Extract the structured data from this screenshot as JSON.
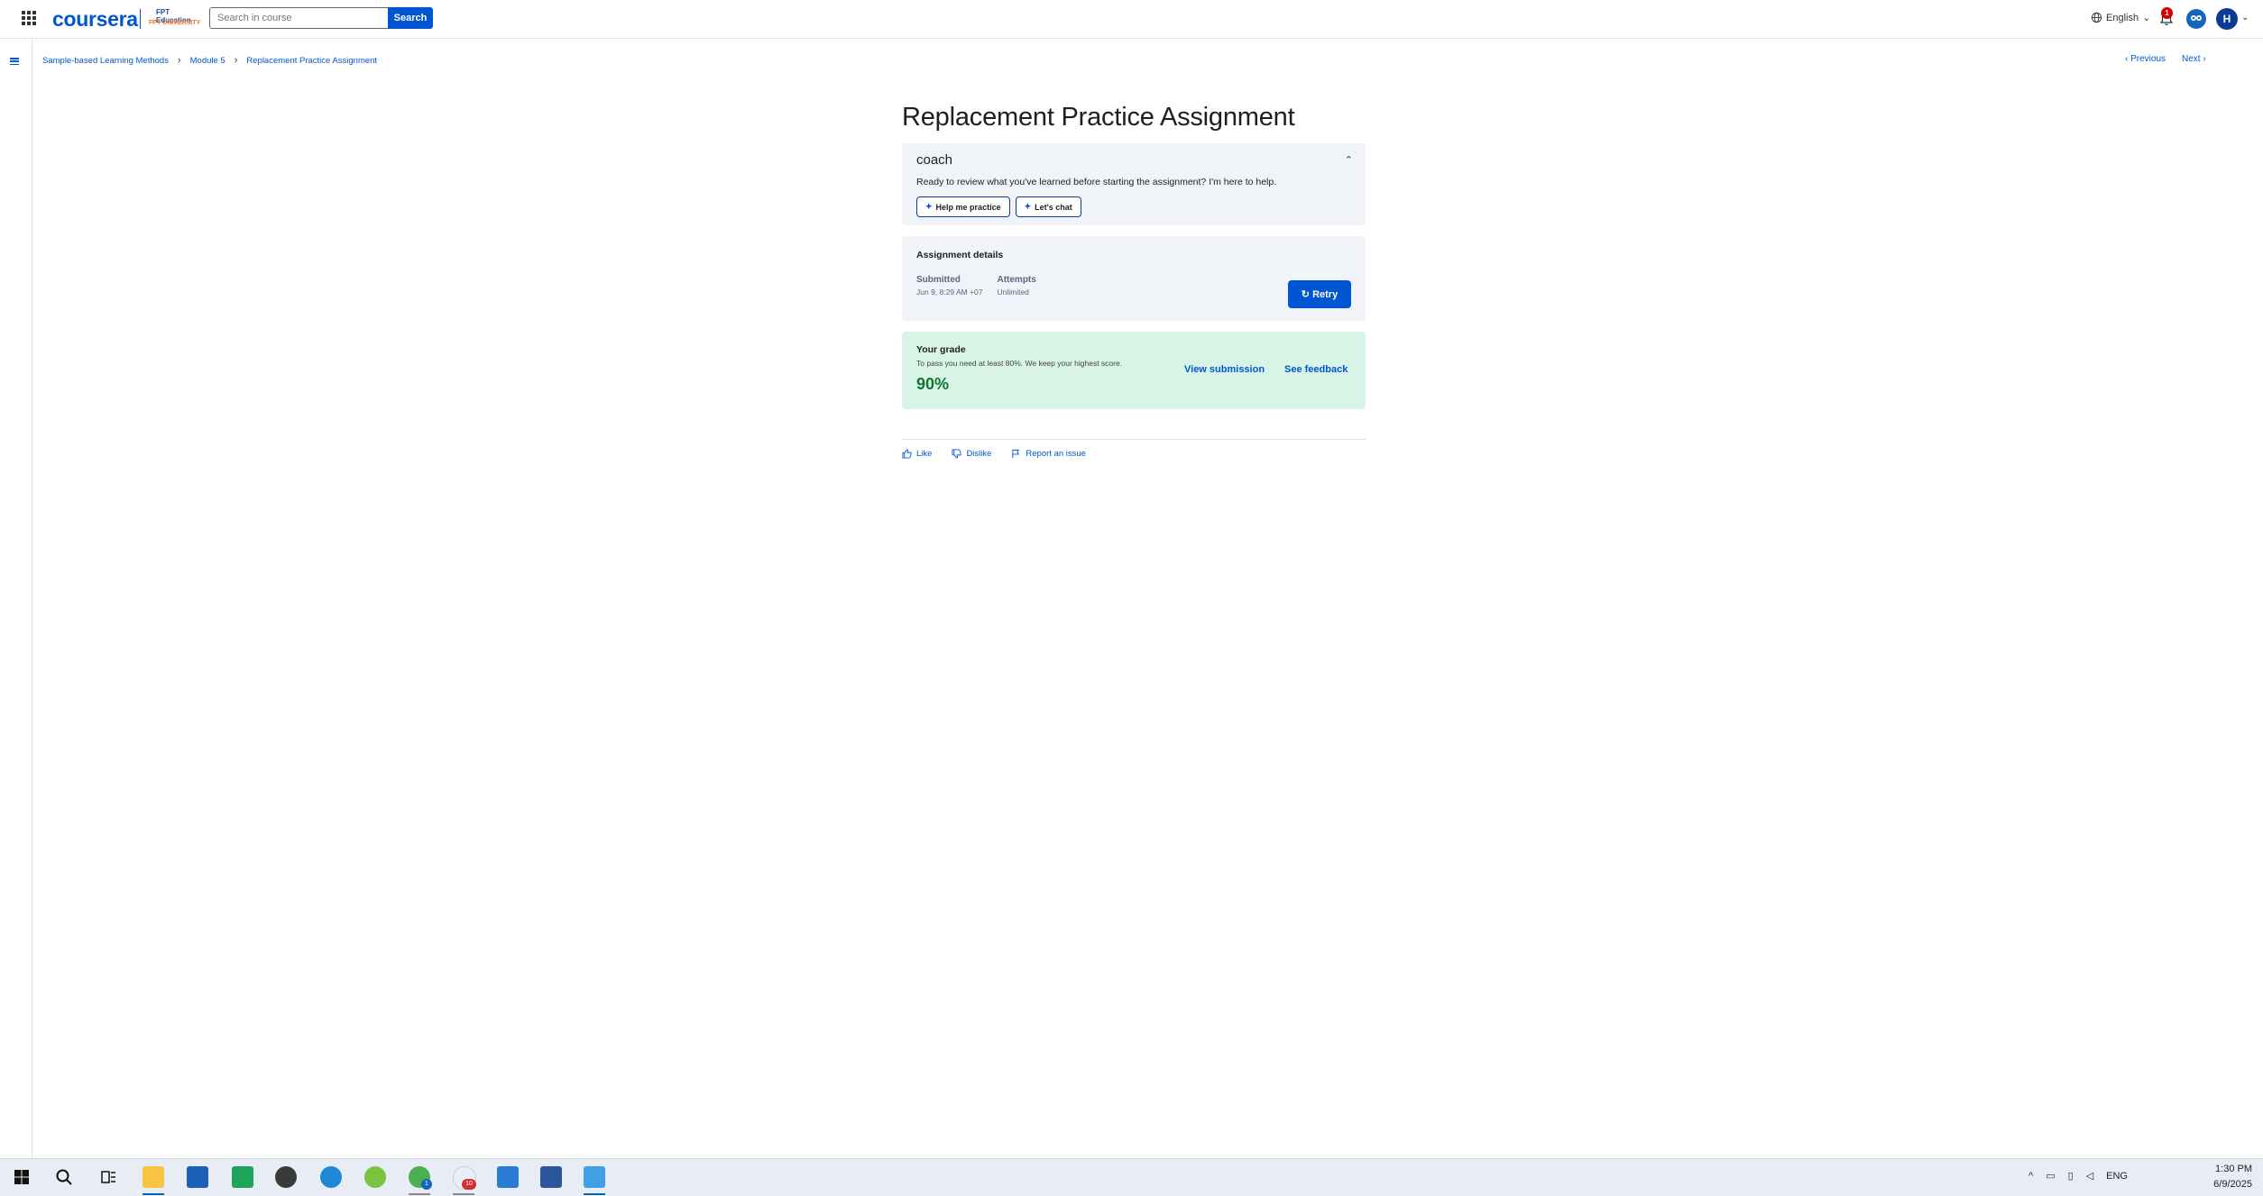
{
  "header": {
    "logo": "coursera",
    "university_top": "FPT Education",
    "university_bottom": "FPT UNIVERSITY",
    "search_placeholder": "Search in course",
    "search_label": "Search",
    "language": "English",
    "notification_count": "1",
    "avatar_initial": "H"
  },
  "breadcrumb": {
    "items": [
      "Sample-based Learning Methods",
      "Module 5",
      "Replacement Practice Assignment"
    ]
  },
  "nav": {
    "previous": "Previous",
    "next": "Next"
  },
  "page": {
    "title": "Replacement Practice Assignment"
  },
  "coach": {
    "name": "coach",
    "message": "Ready to review what you've learned before starting the assignment? I'm here to help.",
    "help_button": "Help me practice",
    "chat_button": "Let's chat"
  },
  "details": {
    "title": "Assignment details",
    "submitted_label": "Submitted",
    "submitted_value": "Jun 9, 8:29 AM +07",
    "attempts_label": "Attempts",
    "attempts_value": "Unlimited",
    "retry_label": "Retry"
  },
  "grade": {
    "title": "Your grade",
    "note": "To pass you need at least 80%. We keep your highest score.",
    "value": "90%",
    "view_submission": "View submission",
    "see_feedback": "See feedback"
  },
  "feedback": {
    "like": "Like",
    "dislike": "Dislike",
    "report": "Report an issue"
  },
  "taskbar": {
    "lang": "ENG",
    "time": "1:30 PM",
    "date": "6/9/2025",
    "vpn_badge": "1",
    "chrome_badge": "10"
  },
  "colors": {
    "brand": "#0056d2",
    "coach_card": "#f0f3f8",
    "grade_card": "#d7f4e7",
    "grade_text": "#137333"
  }
}
